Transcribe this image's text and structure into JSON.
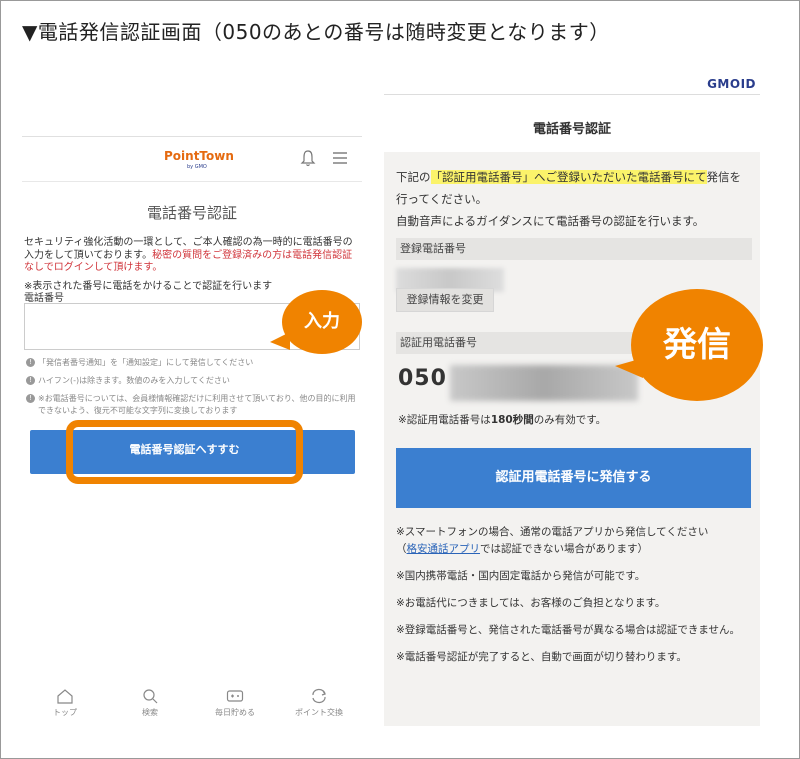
{
  "main_title": "▼電話発信認証画面（050のあとの番号は随時変更となります）",
  "left": {
    "logo": "PointTown",
    "logo_sub": "by GMO",
    "title": "電話番号認証",
    "desc_prefix": "セキュリティ強化活動の一環として、ご本人確認の為一時的に電話番号の入力をして頂いております。",
    "desc_red": "秘密の質問をご登録済みの方は電話発信認証なしでログインして頂けます。",
    "note": "※表示された番号に電話をかけることで認証を行います",
    "phone_label": "電話番号",
    "phone_value": "",
    "hints": [
      "「発信者番号通知」を「通知設定」にして発信してください",
      "ハイフン(-)は除きます。数値のみを入力してください",
      "※お電話番号については、会員様情報確認だけに利用させて頂いており、他の目的に利用できないよう、復元不可能な文字列に変換しております"
    ],
    "next_button": "電話番号認証へすすむ",
    "tabs": [
      "トップ",
      "検索",
      "毎日貯める",
      "ポイント交換"
    ],
    "bubble": "入力"
  },
  "right": {
    "brand": "GMOID",
    "title": "電話番号認証",
    "desc_line1_pre": "下記の",
    "desc_line1_hl": "「認証用電話番号」へご登録いただいた電話番号にて",
    "desc_line1_post": "発信を行ってください。",
    "desc_line2": "自動音声によるガイダンスにて電話番号の認証を行います。",
    "registered_label": "登録電話番号",
    "change_button": "登録情報を変更",
    "auth_label": "認証用電話番号",
    "auth_number_prefix": "050",
    "valid_pre": "※認証用電話番号は",
    "valid_bold": "180秒間",
    "valid_post": "のみ有効です。",
    "call_button": "認証用電話番号に発信する",
    "note1_a": "※スマートフォンの場合、通常の電話アプリから発信してください",
    "note1_b_pre": "（",
    "note1_b_link": "格安通話アプリ",
    "note1_b_post": "では認証できない場合があります）",
    "note2": "※国内携帯電話・国内固定電話から発信が可能です。",
    "note3": "※お電話代につきましては、お客様のご負担となります。",
    "note4": "※登録電話番号と、発信された電話番号が異なる場合は認証できません。",
    "note5": "※電話番号認証が完了すると、自動で画面が切り替わります。",
    "bubble": "発信"
  }
}
